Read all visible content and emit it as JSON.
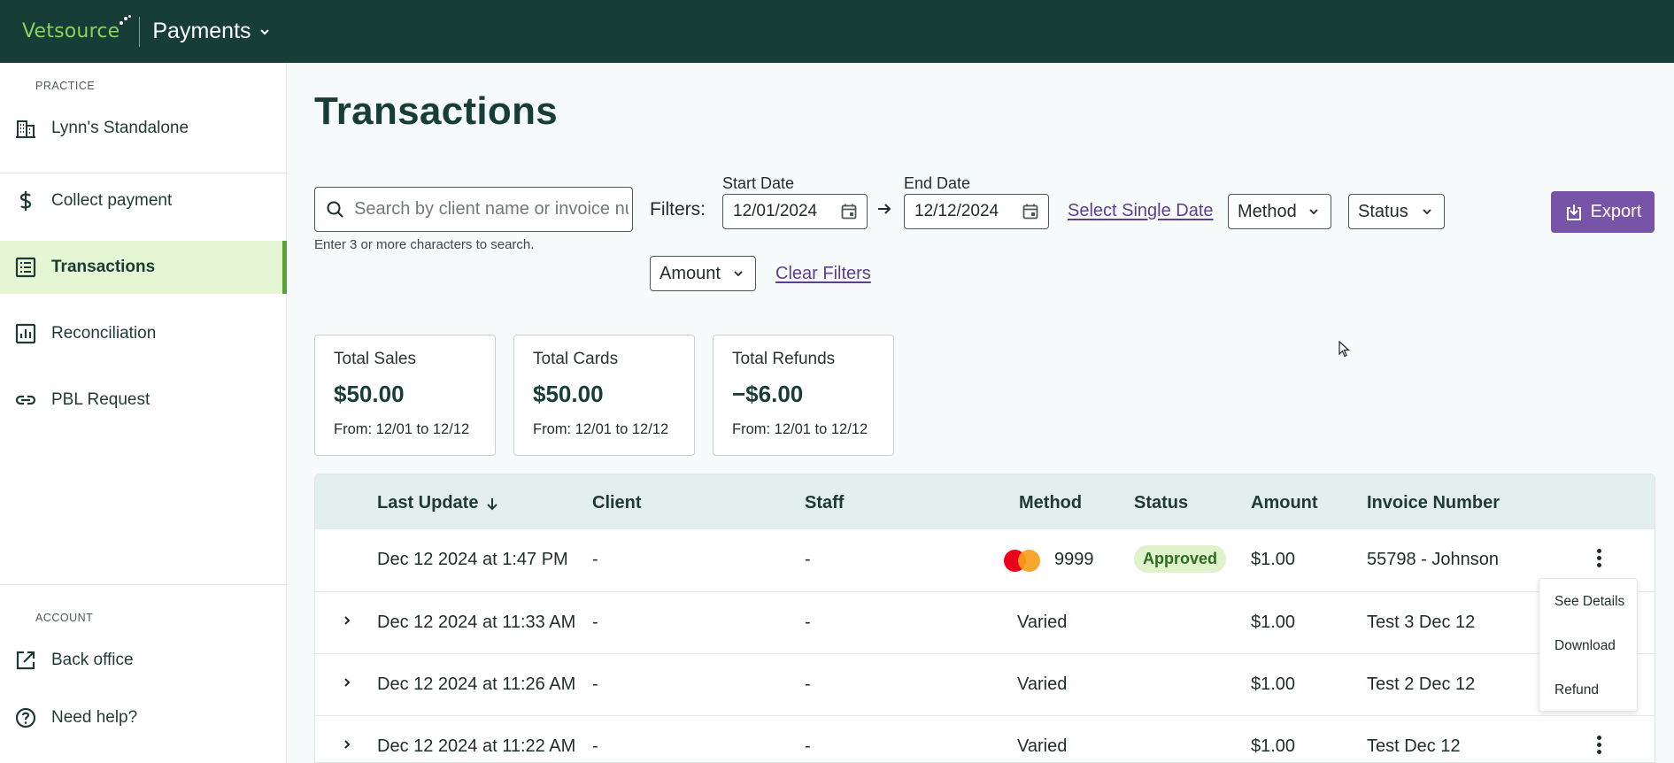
{
  "brand": {
    "name": "Vetsource",
    "app_title": "Payments"
  },
  "sidebar": {
    "practice_label": "PRACTICE",
    "practice_name": "Lynn's Standalone",
    "items": [
      {
        "label": "Collect payment",
        "icon": "dollar-icon"
      },
      {
        "label": "Transactions",
        "icon": "receipt-icon",
        "active": true
      },
      {
        "label": "Reconciliation",
        "icon": "bar-chart-icon"
      },
      {
        "label": "PBL Request",
        "icon": "link-icon"
      }
    ],
    "account_label": "ACCOUNT",
    "account_items": [
      {
        "label": "Back office",
        "icon": "external-link-icon"
      },
      {
        "label": "Need help?",
        "icon": "help-circle-icon"
      }
    ]
  },
  "page": {
    "title": "Transactions"
  },
  "search": {
    "placeholder": "Search by client name or invoice number",
    "value": "",
    "help": "Enter 3 or more characters to search."
  },
  "filters": {
    "label": "Filters:",
    "start_date_label": "Start Date",
    "start_date": "12/01/2024",
    "end_date_label": "End Date",
    "end_date": "12/12/2024",
    "single_date_link": "Select Single Date",
    "method": "Method",
    "status": "Status",
    "amount": "Amount",
    "clear_link": "Clear Filters"
  },
  "export_label": "Export",
  "summary_cards": [
    {
      "title": "Total Sales",
      "value": "$50.00",
      "range": "From: 12/01 to 12/12"
    },
    {
      "title": "Total Cards",
      "value": "$50.00",
      "range": "From: 12/01 to 12/12"
    },
    {
      "title": "Total Refunds",
      "value": "−$6.00",
      "range": "From: 12/01 to 12/12"
    }
  ],
  "table": {
    "columns": [
      "Last Update",
      "Client",
      "Staff",
      "Method",
      "Status",
      "Amount",
      "Invoice Number"
    ],
    "rows": [
      {
        "last_update": "Dec 12 2024 at 1:47 PM",
        "client": "-",
        "staff": "-",
        "method_card": "9999",
        "method_icon": "mastercard-icon",
        "status": "Approved",
        "amount": "$1.00",
        "invoice": "55798 - Johnson"
      },
      {
        "last_update": "Dec 12 2024 at 11:33 AM",
        "client": "-",
        "staff": "-",
        "method": "Varied",
        "amount": "$1.00",
        "invoice": "Test 3 Dec 12"
      },
      {
        "last_update": "Dec 12 2024 at 11:26 AM",
        "client": "-",
        "staff": "-",
        "method": "Varied",
        "amount": "$1.00",
        "invoice": "Test 2 Dec 12"
      },
      {
        "last_update": "Dec 12 2024 at 11:22 AM",
        "client": "-",
        "staff": "-",
        "method": "Varied",
        "amount": "$1.00",
        "invoice": "Test Dec 12"
      }
    ]
  },
  "row_menu": {
    "items": [
      "See Details",
      "Download",
      "Refund"
    ]
  },
  "colors": {
    "topbar": "#163e36",
    "brand_green": "#8bd15c",
    "active_bg": "#e4f6d4",
    "accent_purple": "#7754a8",
    "approved_bg": "#dff2cc"
  }
}
